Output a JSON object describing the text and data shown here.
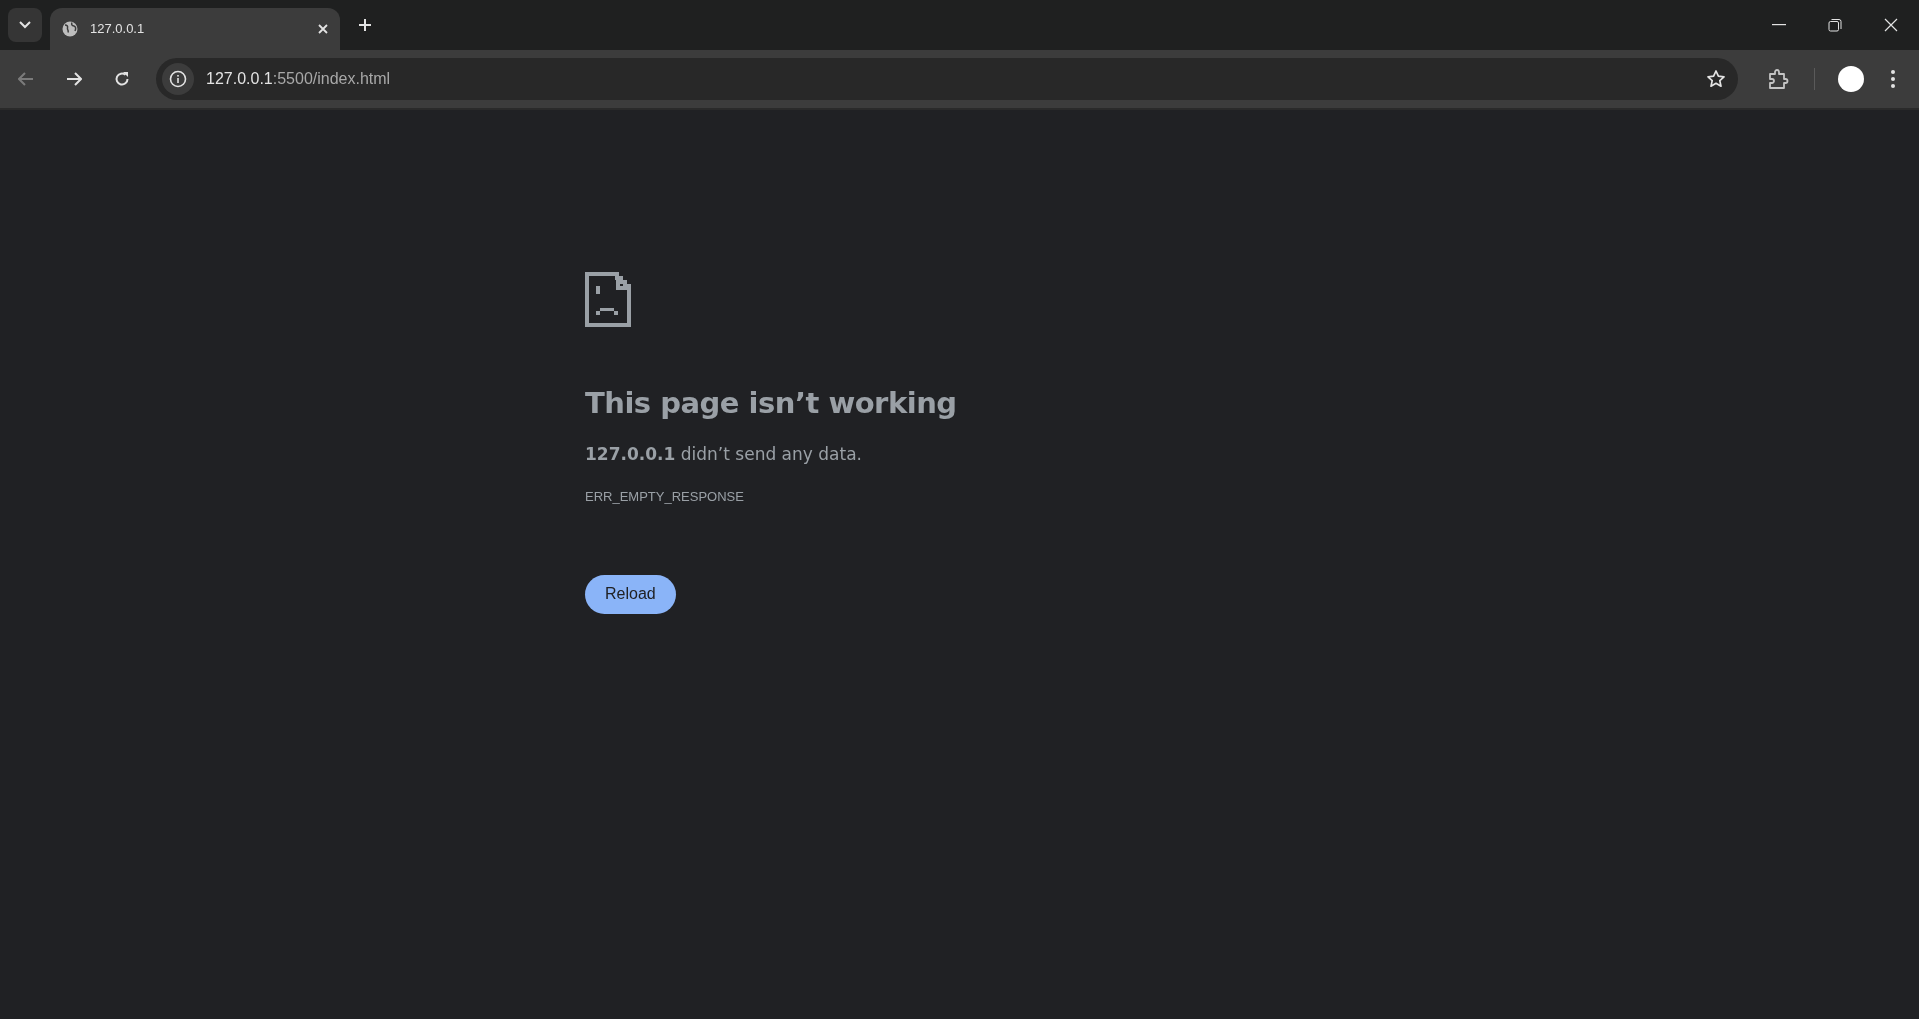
{
  "tabs": [
    {
      "title": "127.0.0.1",
      "selected": true
    }
  ],
  "address_bar": {
    "host": "127.0.0.1",
    "path": ":5500/index.html"
  },
  "error": {
    "heading": "This page isn’t working",
    "message": "**127.0.0.1** didn’t send any data.",
    "code": "ERR_EMPTY_RESPONSE",
    "button": "Reload"
  }
}
